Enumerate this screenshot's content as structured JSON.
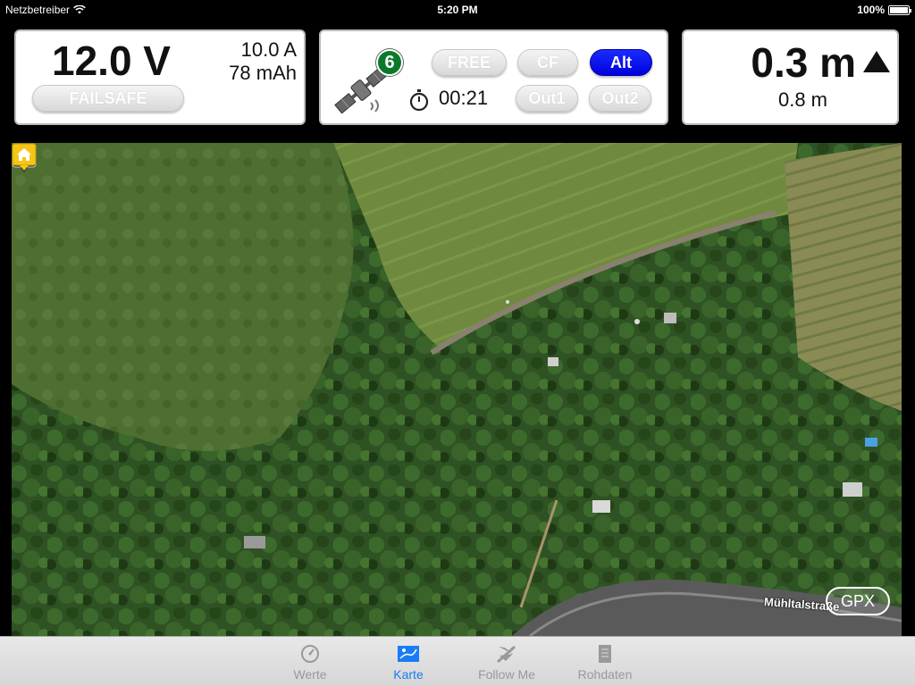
{
  "status_bar": {
    "carrier": "Netzbetreiber",
    "time": "5:20 PM",
    "battery_percent": "100%",
    "battery_level": 1.0
  },
  "battery_panel": {
    "voltage": "12.0 V",
    "current": "10.0 A",
    "capacity_used": "78 mAh",
    "failsafe_label": "FAILSAFE"
  },
  "flight_panel": {
    "satellite_count": "6",
    "timer": "00:21",
    "buttons": {
      "free": "FREE",
      "cf": "CF",
      "alt": "Alt",
      "out1": "Out1",
      "out2": "Out2"
    },
    "active_mode": "Alt"
  },
  "altitude_panel": {
    "altitude": "0.3 m",
    "secondary": "0.8 m",
    "trend_icon": "up-triangle-icon"
  },
  "map": {
    "street_label": "Mühltalstraße",
    "gpx_label": "GPX",
    "markers": [
      "plane-marker-icon",
      "home-marker-icon"
    ],
    "colors": {
      "home_marker": "#f5c518",
      "plane_marker": "#2a2a2a"
    }
  },
  "tab_bar": {
    "tabs": [
      {
        "label": "Werte",
        "icon": "gauge-icon"
      },
      {
        "label": "Karte",
        "icon": "map-icon"
      },
      {
        "label": "Follow Me",
        "icon": "plane-icon"
      },
      {
        "label": "Rohdaten",
        "icon": "document-icon"
      }
    ],
    "active_tab": "Karte",
    "active_color": "#1a7cf5"
  }
}
